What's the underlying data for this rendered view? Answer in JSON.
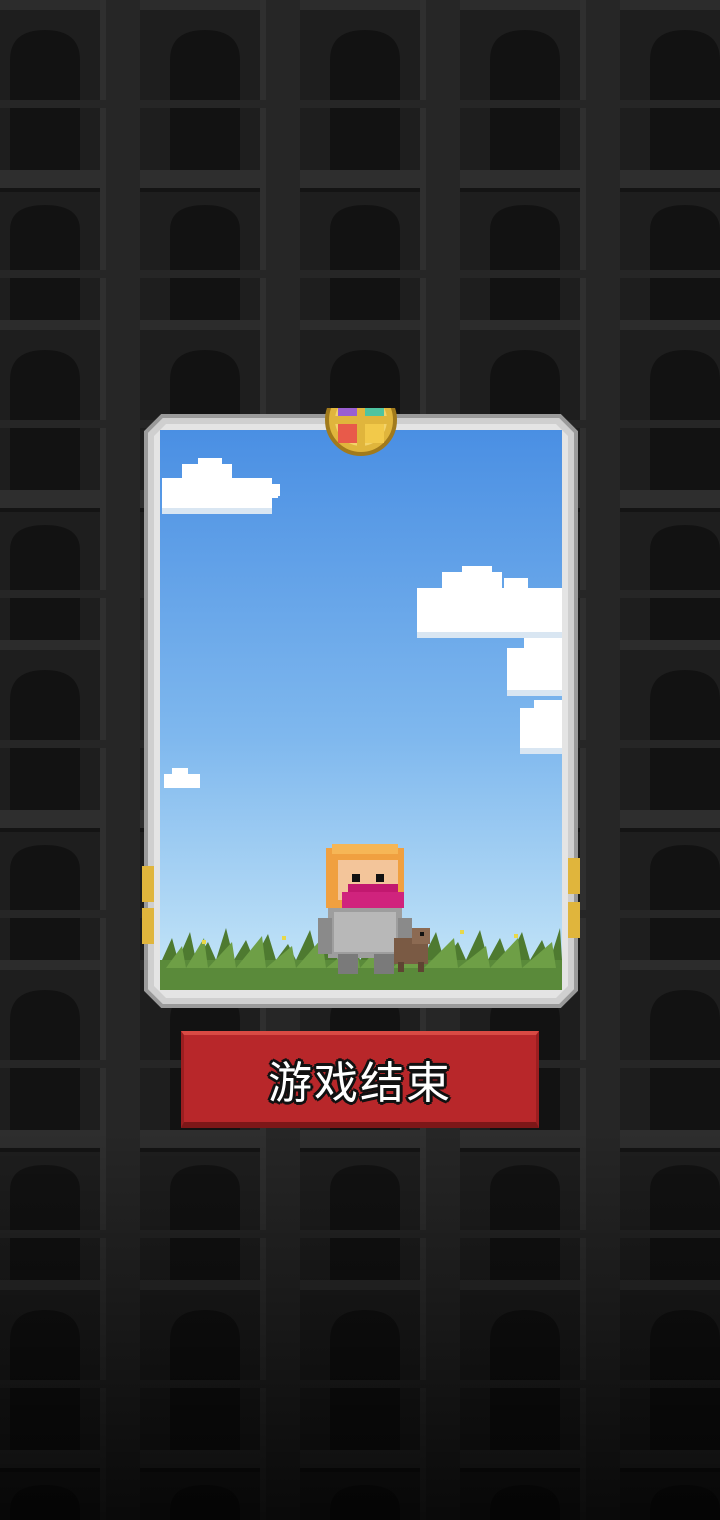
{
  "game": {
    "end_button_label": "游戏结束"
  },
  "colors": {
    "background": "#1c1c1c",
    "sky_top": "#4a8fe3",
    "sky_bottom": "#bfe3f7",
    "button_red": "#b8272a",
    "frame_silver": "#d8d8d8"
  },
  "icons": {
    "medallion": "compass-medallion-icon"
  }
}
